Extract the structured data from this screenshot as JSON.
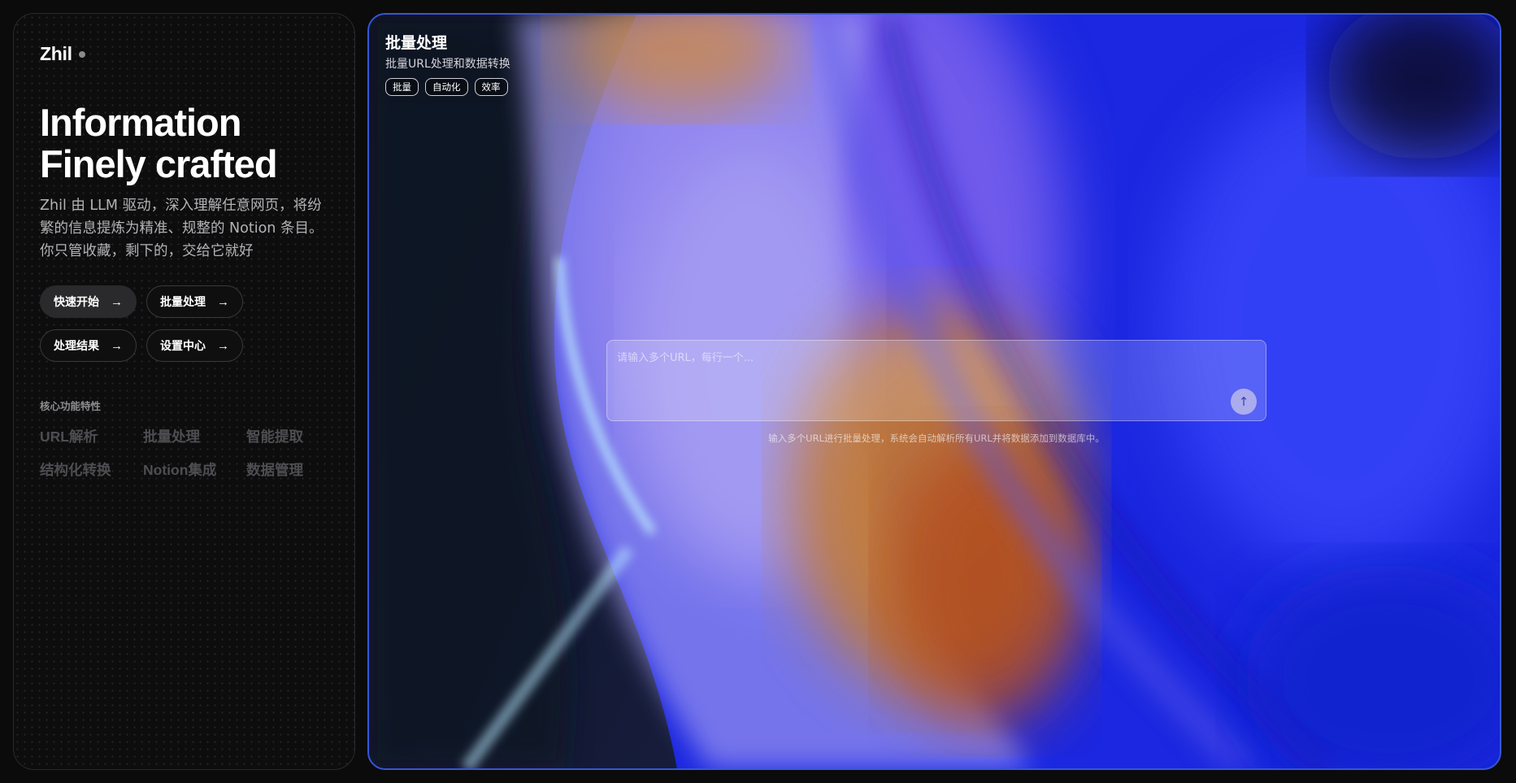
{
  "brand": {
    "name": "Zhil"
  },
  "hero": {
    "title_line1": "Information",
    "title_line2": "Finely crafted",
    "description": "Zhil 由 LLM 驱动，深入理解任意网页，将纷繁的信息提炼为精准、规整的 Notion 条目。你只管收藏，剩下的，交给它就好"
  },
  "nav": {
    "buttons": [
      {
        "label": "快速开始",
        "active": true
      },
      {
        "label": "批量处理",
        "active": false
      },
      {
        "label": "处理结果",
        "active": false
      },
      {
        "label": "设置中心",
        "active": false
      }
    ],
    "arrow_icon": "arrow-right-icon"
  },
  "features": {
    "title": "核心功能特性",
    "items": [
      "URL解析",
      "批量处理",
      "智能提取",
      "结构化转换",
      "Notion集成",
      "数据管理"
    ]
  },
  "main": {
    "title": "批量处理",
    "subtitle": "批量URL处理和数据转换",
    "tags": [
      "批量",
      "自动化",
      "效率"
    ],
    "input_placeholder": "请输入多个URL，每行一个...",
    "input_value": "",
    "send_icon": "arrow-up-icon",
    "hint": "输入多个URL进行批量处理，系统会自动解析所有URL并将数据添加到数据库中。"
  },
  "colors": {
    "accent_border": "#3657d6",
    "background": "#0b0b0c",
    "panel": "#0d0d0e"
  }
}
